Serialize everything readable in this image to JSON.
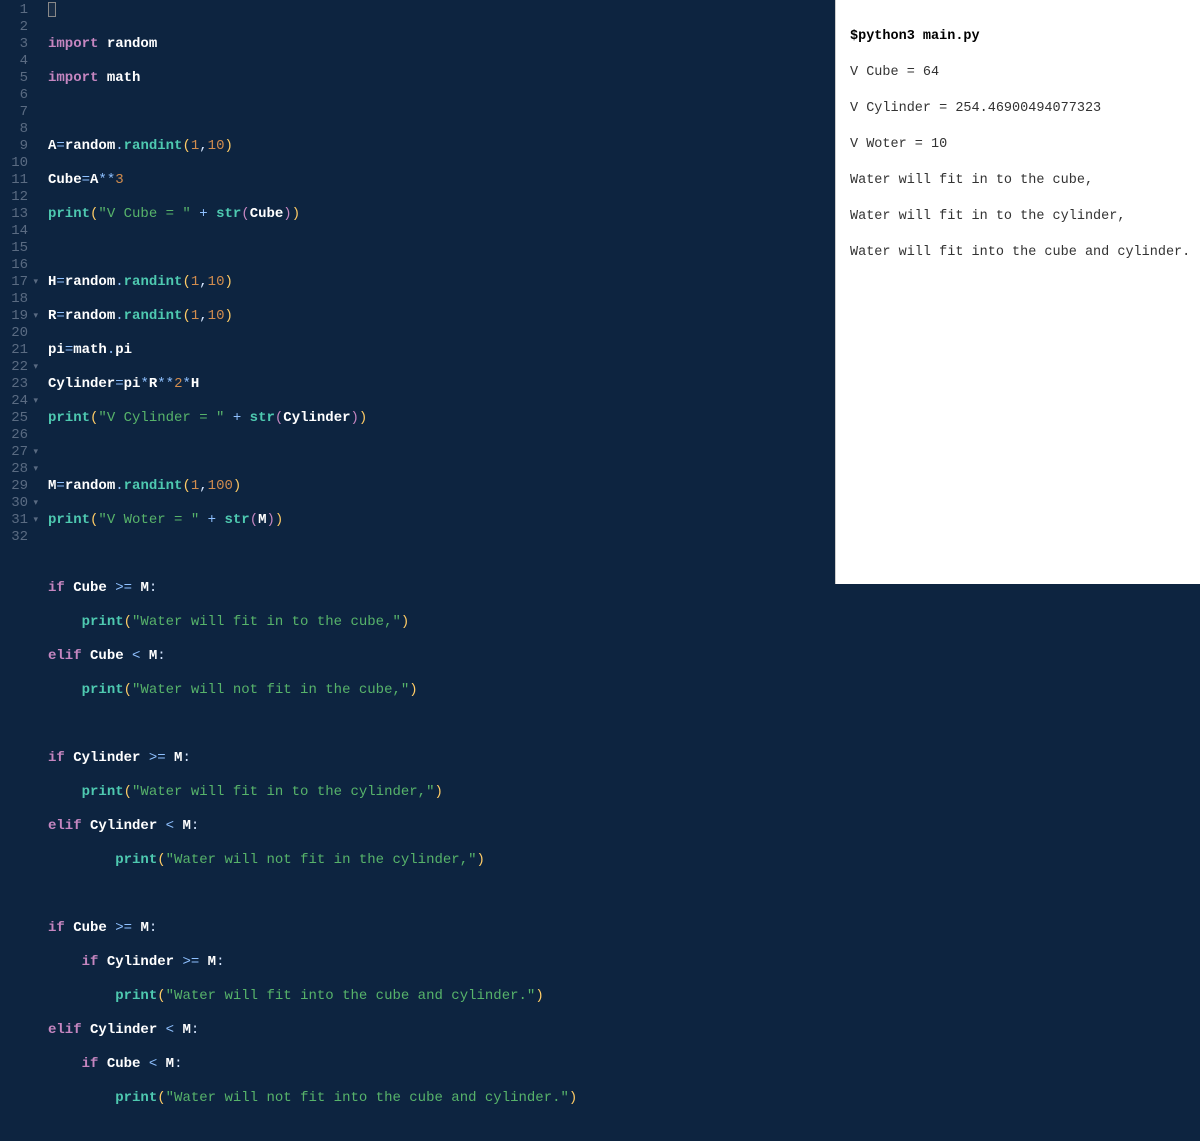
{
  "editor": {
    "gutter": [
      {
        "n": "1"
      },
      {
        "n": "2"
      },
      {
        "n": "3"
      },
      {
        "n": "4"
      },
      {
        "n": "5"
      },
      {
        "n": "6"
      },
      {
        "n": "7"
      },
      {
        "n": "8"
      },
      {
        "n": "9"
      },
      {
        "n": "10"
      },
      {
        "n": "11"
      },
      {
        "n": "12"
      },
      {
        "n": "13"
      },
      {
        "n": "14"
      },
      {
        "n": "15"
      },
      {
        "n": "16"
      },
      {
        "n": "17",
        "f": true
      },
      {
        "n": "18"
      },
      {
        "n": "19",
        "f": true
      },
      {
        "n": "20"
      },
      {
        "n": "21"
      },
      {
        "n": "22",
        "f": true
      },
      {
        "n": "23"
      },
      {
        "n": "24",
        "f": true
      },
      {
        "n": "25"
      },
      {
        "n": "26"
      },
      {
        "n": "27",
        "f": true
      },
      {
        "n": "28",
        "f": true
      },
      {
        "n": "29"
      },
      {
        "n": "30",
        "f": true
      },
      {
        "n": "31",
        "f": true
      },
      {
        "n": "32"
      }
    ],
    "code": {
      "l1_import": "import",
      "l1_mod": "random",
      "l2_import": "import",
      "l2_mod": "math",
      "l4_a": "A",
      "l4_eq": "=",
      "l4_r": "random",
      "l4_dot": ".",
      "l4_fn": "randint",
      "l4_p1": "(",
      "l4_n1": "1",
      "l4_c": ",",
      "l4_n2": "10",
      "l4_p2": ")",
      "l5_a": "Cube",
      "l5_eq": "=",
      "l5_b": "A",
      "l5_op": "**",
      "l5_n": "3",
      "l6_fn": "print",
      "l6_p1": "(",
      "l6_s": "\"V Cube = \"",
      "l6_plus": " + ",
      "l6_str": "str",
      "l6_p2": "(",
      "l6_v": "Cube",
      "l6_p3": ")",
      "l6_p4": ")",
      "l8_a": "H",
      "l8_eq": "=",
      "l8_r": "random",
      "l8_dot": ".",
      "l8_fn": "randint",
      "l8_p1": "(",
      "l8_n1": "1",
      "l8_c": ",",
      "l8_n2": "10",
      "l8_p2": ")",
      "l9_a": "R",
      "l9_eq": "=",
      "l9_r": "random",
      "l9_dot": ".",
      "l9_fn": "randint",
      "l9_p1": "(",
      "l9_n1": "1",
      "l9_c": ",",
      "l9_n2": "10",
      "l9_p2": ")",
      "l10_a": "pi",
      "l10_eq": "=",
      "l10_r": "math",
      "l10_dot": ".",
      "l10_p": "pi",
      "l11_a": "Cylinder",
      "l11_eq": "=",
      "l11_b": "pi",
      "l11_m1": "*",
      "l11_c": "R",
      "l11_op": "**",
      "l11_n": "2",
      "l11_m2": "*",
      "l11_d": "H",
      "l12_fn": "print",
      "l12_p1": "(",
      "l12_s": "\"V Cylinder = \"",
      "l12_plus": " + ",
      "l12_str": "str",
      "l12_p2": "(",
      "l12_v": "Cylinder",
      "l12_p3": ")",
      "l12_p4": ")",
      "l14_a": "M",
      "l14_eq": "=",
      "l14_r": "random",
      "l14_dot": ".",
      "l14_fn": "randint",
      "l14_p1": "(",
      "l14_n1": "1",
      "l14_c": ",",
      "l14_n2": "100",
      "l14_p2": ")",
      "l15_fn": "print",
      "l15_p1": "(",
      "l15_s": "\"V Woter = \"",
      "l15_plus": " + ",
      "l15_str": "str",
      "l15_p2": "(",
      "l15_v": "M",
      "l15_p3": ")",
      "l15_p4": ")",
      "l17_if": "if",
      "l17_v": "Cube",
      "l17_op": " >= ",
      "l17_m": "M",
      "l17_c": ":",
      "l18_fn": "print",
      "l18_p1": "(",
      "l18_s": "\"Water will fit in to the cube,\"",
      "l18_p2": ")",
      "l19_elif": "elif",
      "l19_v": "Cube",
      "l19_op": " < ",
      "l19_m": "M",
      "l19_c": ":",
      "l20_fn": "print",
      "l20_p1": "(",
      "l20_s": "\"Water will not fit in the cube,\"",
      "l20_p2": ")",
      "l22_if": "if",
      "l22_v": "Cylinder",
      "l22_op": " >= ",
      "l22_m": "M",
      "l22_c": ":",
      "l23_fn": "print",
      "l23_p1": "(",
      "l23_s": "\"Water will fit in to the cylinder,\"",
      "l23_p2": ")",
      "l24_elif": "elif",
      "l24_v": "Cylinder",
      "l24_op": " < ",
      "l24_m": "M",
      "l24_c": ":",
      "l25_fn": "print",
      "l25_p1": "(",
      "l25_s": "\"Water will not fit in the cylinder,\"",
      "l25_p2": ")",
      "l27_if": "if",
      "l27_v": "Cube",
      "l27_op": " >= ",
      "l27_m": "M",
      "l27_c": ":",
      "l28_if": "if",
      "l28_v": "Cylinder",
      "l28_op": " >= ",
      "l28_m": "M",
      "l28_c": ":",
      "l29_fn": "print",
      "l29_p1": "(",
      "l29_s": "\"Water will fit into the cube and cylinder.\"",
      "l29_p2": ")",
      "l30_elif": "elif",
      "l30_v": "Cylinder",
      "l30_op": " < ",
      "l30_m": "M",
      "l30_c": ":",
      "l31_if": "if",
      "l31_v": "Cube",
      "l31_op": " < ",
      "l31_m": "M",
      "l31_c": ":",
      "l32_fn": "print",
      "l32_p1": "(",
      "l32_s": "\"Water will not fit into the cube and cylinder.\"",
      "l32_p2": ")"
    }
  },
  "output": {
    "cmd": "$python3 main.py",
    "lines": [
      "V Cube = 64",
      "V Cylinder = 254.46900494077323",
      "V Woter = 10",
      "Water will fit in to the cube,",
      "Water will fit in to the cylinder,",
      "Water will fit into the cube and cylinder."
    ]
  }
}
